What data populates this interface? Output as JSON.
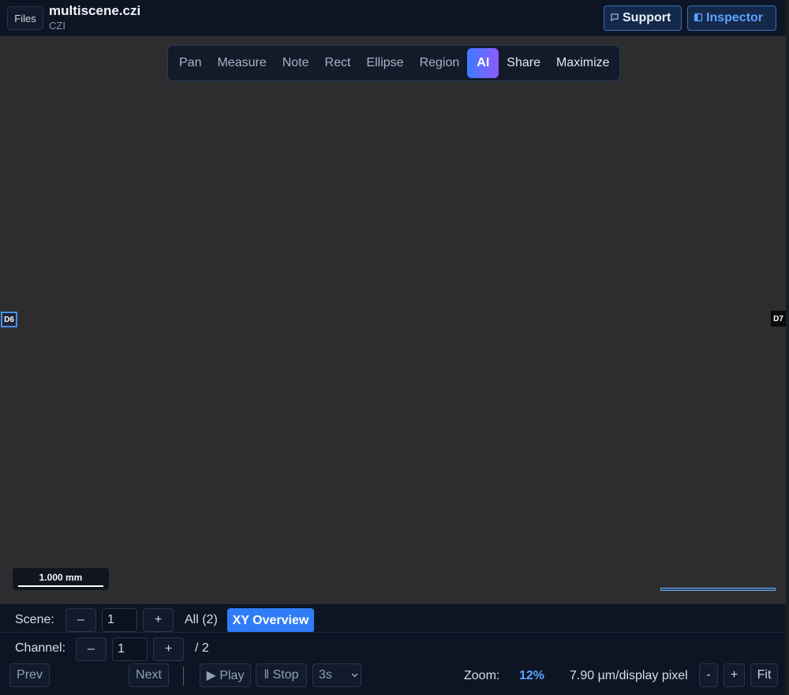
{
  "header": {
    "files_label": "Files",
    "file_name": "multiscene.czi",
    "file_type": "CZI",
    "support_label": "Support",
    "inspector_label": "Inspector",
    "support_icon": "chat-icon",
    "inspector_icon": "panel-icon"
  },
  "toolbar": {
    "tools": [
      "Pan",
      "Measure",
      "Note",
      "Rect",
      "Ellipse",
      "Region",
      "AI",
      "Share",
      "Maximize"
    ],
    "active": "AI"
  },
  "viewer": {
    "marker_left": "D6",
    "marker_right": "D7",
    "scale_label": "1.000 mm"
  },
  "scene": {
    "label": "Scene:",
    "minus": "–",
    "value": "1",
    "plus": "+",
    "all_label": "All (2)",
    "overview_label": "XY Overview"
  },
  "channel": {
    "label": "Channel:",
    "minus": "–",
    "value": "1",
    "plus": "+",
    "total": "/ 2"
  },
  "playback": {
    "prev": "Prev",
    "next": "Next",
    "play": "▶ Play",
    "stop": "‖ Stop",
    "interval": "3s"
  },
  "zoom": {
    "label": "Zoom:",
    "value": "12%",
    "resolution": "7.90 µm/display pixel",
    "minus": "-",
    "plus": "+",
    "fit": "Fit"
  },
  "colors": {
    "accent": "#2f7cf6",
    "ai_gradient_start": "#3d7bff",
    "ai_gradient_end": "#8c5cff",
    "header_bg": "#0d1524",
    "canvas_bg": "#2d2d30"
  }
}
